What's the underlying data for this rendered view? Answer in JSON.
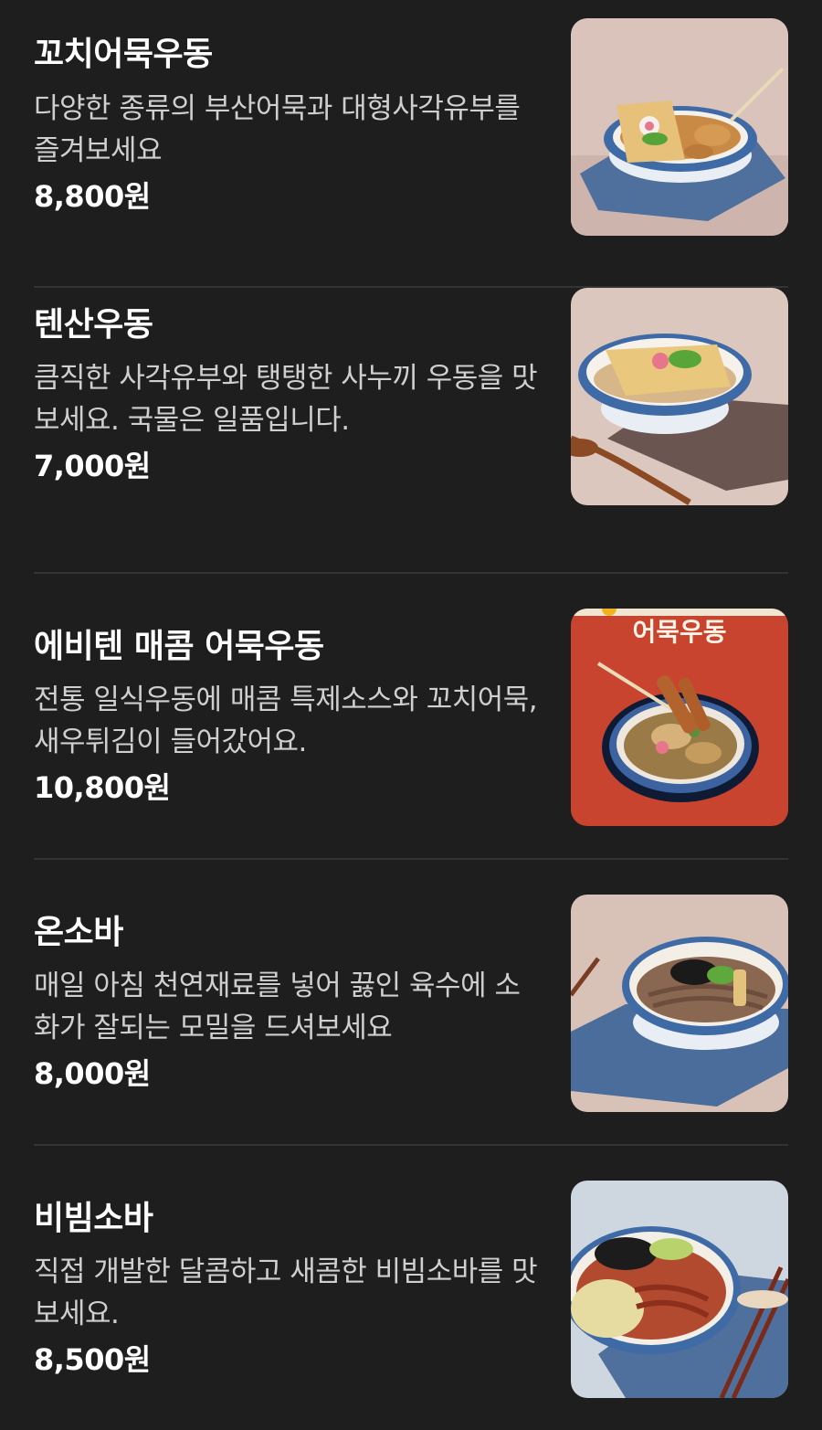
{
  "menu": [
    {
      "name": "꼬치어묵우동",
      "description": "다양한 종류의 부산어묵과 대형사각유부를 즐겨보세요",
      "price": "8,800원",
      "image_icon": "fishcake-skewer-udon-photo"
    },
    {
      "name": "텐산우동",
      "description": "큼직한 사각유부와 탱탱한 사누끼 우동을 맛보세요. 국물은 일품입니다.",
      "price": "7,000원",
      "image_icon": "tensan-udon-photo"
    },
    {
      "name": "에비텐 매콤 어묵우동",
      "description": "전통 일식우동에 매콤 특제소스와 꼬치어묵, 새우튀김이 들어갔어요.",
      "price": "10,800원",
      "image_icon": "spicy-ebiten-udon-photo",
      "image_caption": "어묵우동"
    },
    {
      "name": "온소바",
      "description": "매일 아침 천연재료를 넣어 끓인 육수에 소화가 잘되는 모밀을 드셔보세요",
      "price": "8,000원",
      "image_icon": "hot-soba-photo"
    },
    {
      "name": "비빔소바",
      "description": "직접 개발한 달콤하고 새콤한 비빔소바를 맛보세요.",
      "price": "8,500원",
      "image_icon": "bibim-soba-photo"
    }
  ],
  "colors": {
    "background": "#1e1e1e",
    "divider": "#333333",
    "title": "#ffffff",
    "description": "#cfcfcf",
    "spicy_banner": "#c8442f"
  }
}
